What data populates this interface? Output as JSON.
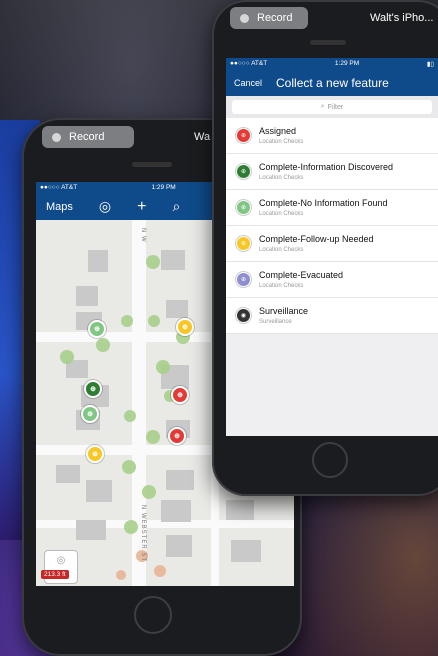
{
  "left_phone": {
    "record_label": "Record",
    "device_name": "Wa",
    "status": {
      "carrier": "●●○○○ AT&T",
      "time": "1:29 PM"
    },
    "nav": {
      "title": "Maps",
      "plus": "+",
      "search": "⌕",
      "locate": "◎"
    },
    "streets": [
      "N W",
      "N WEBSTER ST"
    ],
    "scale": "213.3 ft"
  },
  "right_phone": {
    "record_label": "Record",
    "device_name": "Walt's iPho...",
    "status": {
      "carrier": "●●○○○ AT&T",
      "time": "1:29 PM"
    },
    "nav": {
      "cancel": "Cancel",
      "title": "Collect a new feature"
    },
    "filter_placeholder": "Filter",
    "features": [
      {
        "name": "Assigned",
        "sub": "Location Checks",
        "color": "#e53935"
      },
      {
        "name": "Complete-Information Discovered",
        "sub": "Location Checks",
        "color": "#2e7d32"
      },
      {
        "name": "Complete-No Information Found",
        "sub": "Location Checks",
        "color": "#81c784"
      },
      {
        "name": "Complete-Follow-up Needed",
        "sub": "Location Checks",
        "color": "#f9c623"
      },
      {
        "name": "Complete-Evacuated",
        "sub": "Location Checks",
        "color": "#8e8ed0"
      },
      {
        "name": "Surveillance",
        "sub": "Surveillance",
        "color": "#333333"
      }
    ]
  }
}
